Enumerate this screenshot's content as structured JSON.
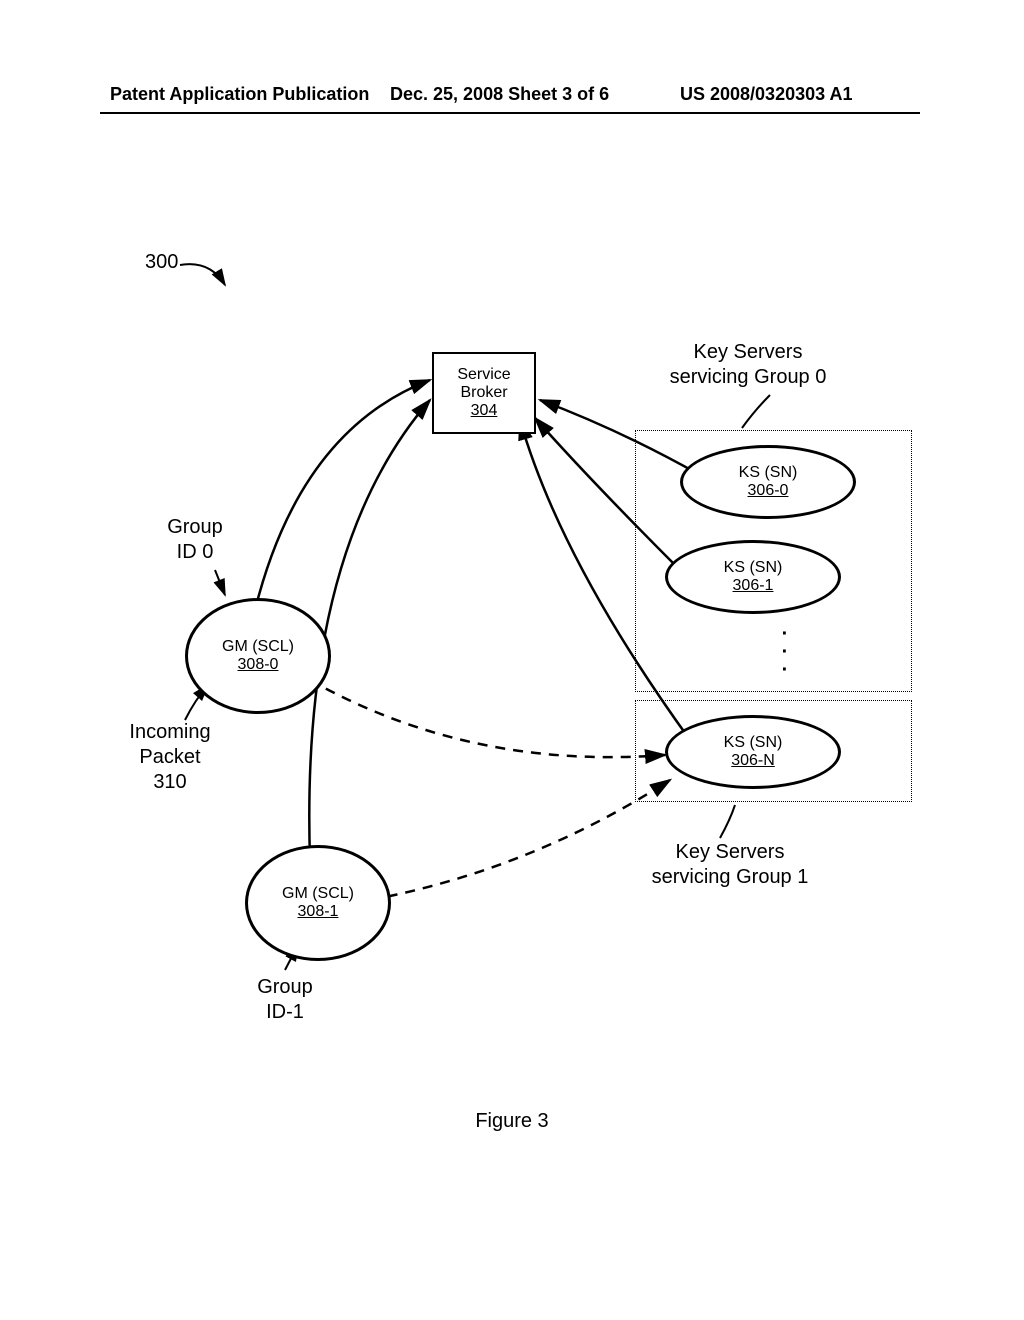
{
  "header": {
    "left": "Patent Application Publication",
    "mid": "Dec. 25, 2008  Sheet 3 of 6",
    "right": "US 2008/0320303 A1"
  },
  "labels": {
    "figure_ref": "300",
    "broker_line1": "Service",
    "broker_line2": "Broker",
    "broker_ref": "304",
    "ks_group0_title": "Key Servers\nservicing Group 0",
    "ks0_line1": "KS (SN)",
    "ks0_ref": "306-0",
    "ks1_line1": "KS (SN)",
    "ks1_ref": "306-1",
    "ksn_line1": "KS (SN)",
    "ksn_ref": "306-N",
    "ks_group1_title": "Key Servers\nservicing Group 1",
    "gm0_line1": "GM (SCL)",
    "gm0_ref": "308-0",
    "gm1_line1": "GM (SCL)",
    "gm1_ref": "308-1",
    "group_id0": "Group\nID 0",
    "group_id1": "Group\nID-1",
    "incoming": "Incoming\nPacket\n310",
    "dots": "·\n·\n·"
  },
  "caption": "Figure 3"
}
